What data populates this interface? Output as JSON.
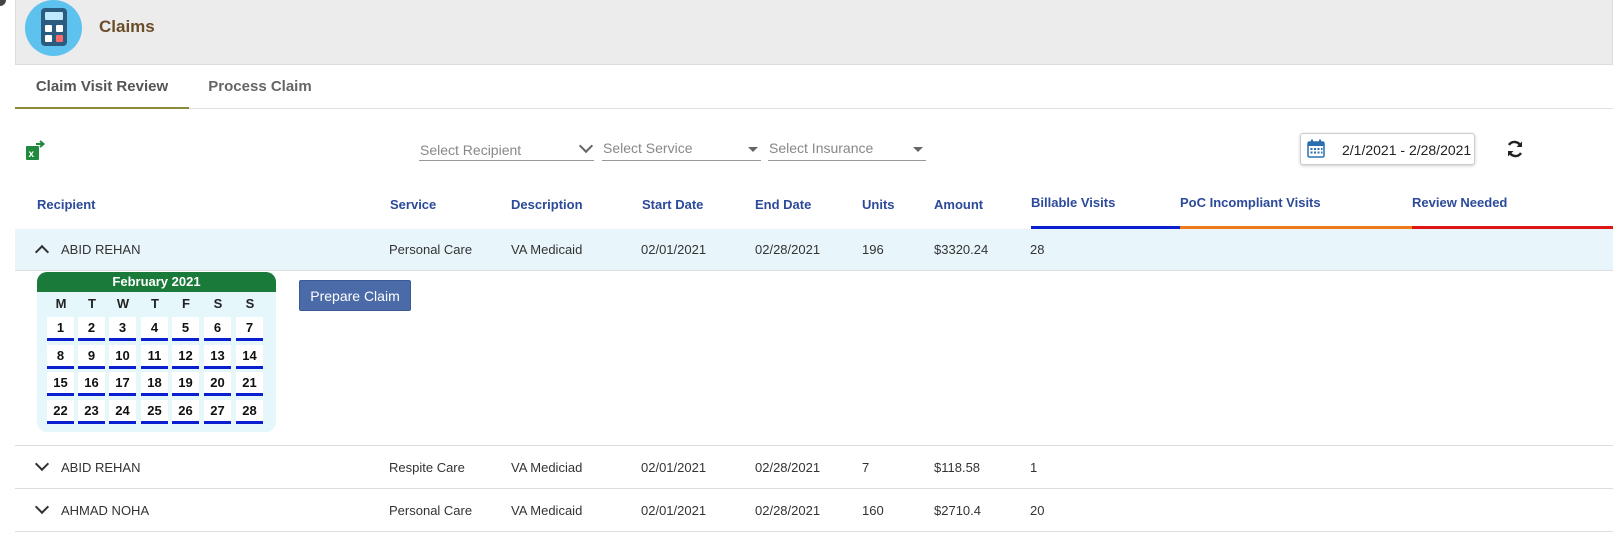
{
  "header": {
    "title": "Claims",
    "icon": "calculator-icon"
  },
  "tabs": [
    {
      "label": "Claim Visit Review",
      "active": true
    },
    {
      "label": "Process Claim",
      "active": false
    }
  ],
  "filters": {
    "recipient_placeholder": "Select Recipient",
    "service_placeholder": "Select Service",
    "insurance_placeholder": "Select Insurance",
    "date_range": "2/1/2021 - 2/28/2021"
  },
  "columns": {
    "recipient": "Recipient",
    "service": "Service",
    "description": "Description",
    "start_date": "Start Date",
    "end_date": "End Date",
    "units": "Units",
    "amount": "Amount",
    "billable": "Billable Visits",
    "poc": "PoC Incompliant Visits",
    "review": "Review Needed"
  },
  "legend_colors": {
    "billable": "#0a1fd0",
    "poc": "#f07a1a",
    "review": "#e01515"
  },
  "rows": [
    {
      "recipient": "ABID REHAN",
      "service": "Personal Care",
      "description": "VA Medicaid",
      "start": "02/01/2021",
      "end": "02/28/2021",
      "units": "196",
      "amount": "$3320.24",
      "billable": "28",
      "expanded": true
    },
    {
      "recipient": "ABID REHAN",
      "service": "Respite Care",
      "description": "VA Mediciad",
      "start": "02/01/2021",
      "end": "02/28/2021",
      "units": "7",
      "amount": "$118.58",
      "billable": "1",
      "expanded": false
    },
    {
      "recipient": "AHMAD NOHA",
      "service": "Personal Care",
      "description": "VA Medicaid",
      "start": "02/01/2021",
      "end": "02/28/2021",
      "units": "160",
      "amount": "$2710.4",
      "billable": "20",
      "expanded": false
    }
  ],
  "calendar": {
    "title": "February 2021",
    "weekdays": [
      "M",
      "T",
      "W",
      "T",
      "F",
      "S",
      "S"
    ],
    "days": [
      "1",
      "2",
      "3",
      "4",
      "5",
      "6",
      "7",
      "8",
      "9",
      "10",
      "11",
      "12",
      "13",
      "14",
      "15",
      "16",
      "17",
      "18",
      "19",
      "20",
      "21",
      "22",
      "23",
      "24",
      "25",
      "26",
      "27",
      "28"
    ]
  },
  "prepare_label": "Prepare Claim"
}
